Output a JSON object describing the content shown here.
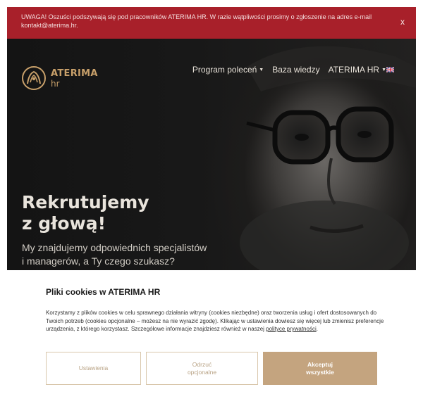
{
  "alert": {
    "text": "UWAGA! Oszuści podszywają się pod pracowników ATERIMA HR. W razie wątpliwości prosimy o zgłoszenie na adres e-mail kontakt@aterima.hr.",
    "close_label": "x"
  },
  "header": {
    "logo": {
      "name": "ATERIMA",
      "sub": "hr"
    },
    "nav": [
      {
        "label": "Program poleceń",
        "dropdown": true
      },
      {
        "label": "Baza wiedzy",
        "dropdown": false
      },
      {
        "label": "ATERIMA HR",
        "dropdown": true
      }
    ],
    "language_icon": "uk-flag-icon"
  },
  "hero": {
    "title_line1": "Rekrutujemy",
    "title_line2": "z głową!",
    "sub_line1": "My znajdujemy odpowiednich specjalistów",
    "sub_line2": "i managerów, a Ty czego szukasz?"
  },
  "cookie": {
    "title": "Pliki cookies w ATERIMA HR",
    "text_before_link": "Korzystamy z plików cookies w celu sprawnego działania witryny (cookies niezbędne) oraz tworzenia usług i ofert dostosowanych do Twoich potrzeb (cookies opcjonalne – możesz na nie wyrazić zgodę). Klikając w ustawienia dowiesz się więcej lub zmienisz preferencje urządzenia, z którego korzystasz. Szczegółowe informacje znajdziesz również w naszej ",
    "link_text": "polityce prywatności",
    "text_after_link": ".",
    "buttons": {
      "settings": "Ustawienia",
      "reject_line1": "Odrzuć",
      "reject_line2": "opcjonalne",
      "accept_line1": "Akceptuj",
      "accept_line2": "wszystkie"
    }
  },
  "colors": {
    "alert_bg": "#a8202a",
    "brand_gold": "#c8a06a",
    "accept_bg": "#c4a47f",
    "hero_bg": "#141414"
  }
}
